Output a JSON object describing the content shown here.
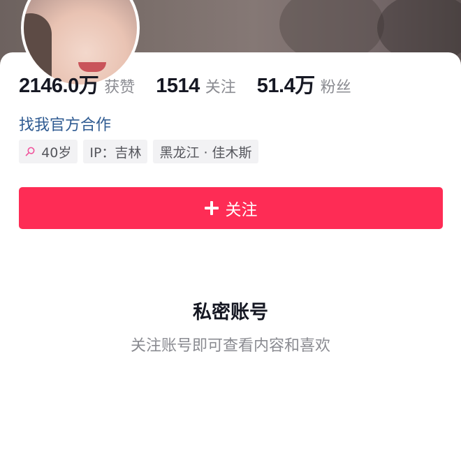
{
  "stats": [
    {
      "value": "2146.0万",
      "label": "获赞"
    },
    {
      "value": "1514",
      "label": "关注"
    },
    {
      "value": "51.4万",
      "label": "粉丝"
    }
  ],
  "profile": {
    "link_text": "找我官方合作",
    "tags": {
      "gender_icon": "female-icon",
      "age": "40岁",
      "ip": "IP：吉林",
      "location": "黑龙江 · 佳木斯"
    }
  },
  "follow_button": {
    "label": "关注",
    "icon": "plus-icon",
    "color": "#fe2c55"
  },
  "private_notice": {
    "title": "私密账号",
    "subtitle": "关注账号即可查看内容和喜欢"
  }
}
